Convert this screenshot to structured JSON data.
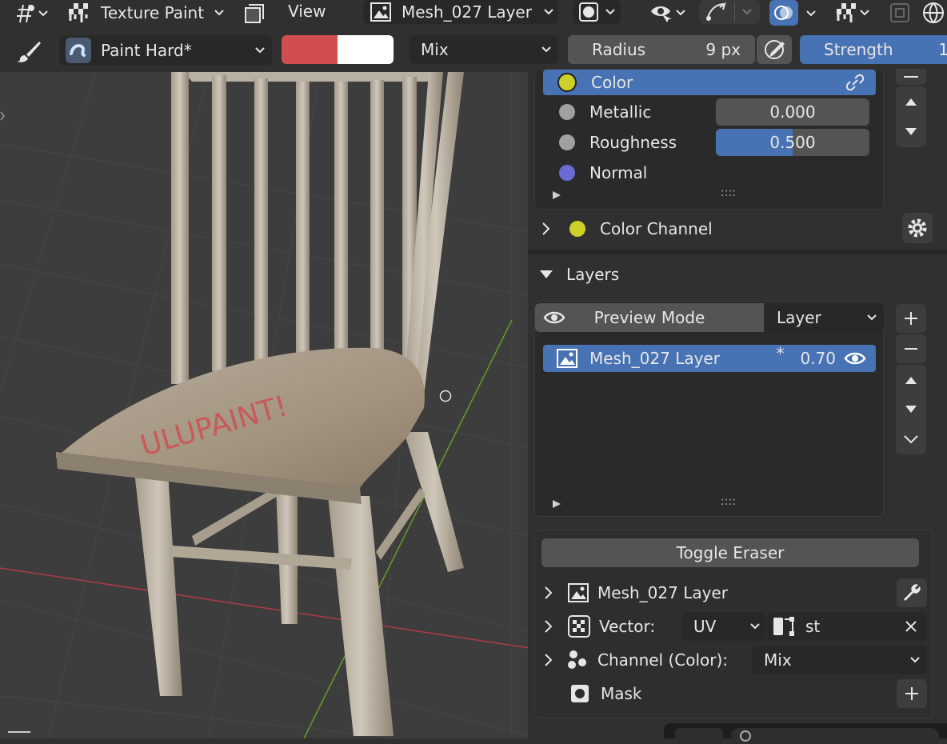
{
  "header": {
    "mode": "Texture Paint",
    "view_menu": "View",
    "image_name": "Mesh_027 Layer"
  },
  "toolbar": {
    "brush_name": "Paint Hard*",
    "blend_mode": "Mix",
    "radius_label": "Radius",
    "radius_value": "9 px",
    "strength_label": "Strength",
    "strength_value": "1",
    "primary_color": "#d14e4e",
    "secondary_color": "#ffffff"
  },
  "viewport": {
    "painted_text": "ULUPAINT!"
  },
  "channels": {
    "items": [
      {
        "label": "Color",
        "color": "#cfcf2a"
      },
      {
        "label": "Metallic",
        "value": "0.000",
        "color": "#a0a0a0"
      },
      {
        "label": "Roughness",
        "value": "0.500",
        "fill": 0.5,
        "color": "#a0a0a0"
      },
      {
        "label": "Normal",
        "color": "#6b6bd6"
      }
    ],
    "grip": "::::",
    "color_channel_label": "Color Channel"
  },
  "layers": {
    "section_label": "Layers",
    "preview_mode_label": "Preview Mode",
    "layer_type": "Layer",
    "items": [
      {
        "name": "Mesh_027 Layer",
        "star": "*",
        "opacity": "0.70"
      }
    ],
    "grip": "::::",
    "toggle_eraser": "Toggle Eraser",
    "layer_name": "Mesh_027 Layer",
    "vector_label": "Vector:",
    "vector_value": "UV",
    "uv_map": "st",
    "channel_label": "Channel (Color):",
    "channel_value": "Mix",
    "mask_label": "Mask"
  }
}
